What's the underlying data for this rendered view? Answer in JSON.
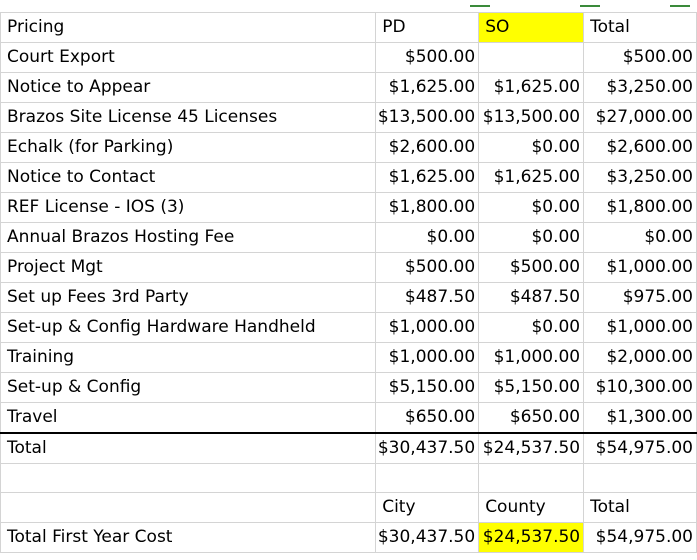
{
  "header": {
    "col0": "Pricing",
    "col1": "PD",
    "col2": "SO",
    "col3": "Total"
  },
  "rows": [
    {
      "label": "Court Export",
      "pd": "$500.00",
      "so": "",
      "total": "$500.00"
    },
    {
      "label": "Notice to Appear",
      "pd": "$1,625.00",
      "so": "$1,625.00",
      "total": "$3,250.00"
    },
    {
      "label": "Brazos Site License 45 Licenses",
      "pd": "$13,500.00",
      "so": "$13,500.00",
      "total": "$27,000.00"
    },
    {
      "label": "Echalk (for Parking)",
      "pd": "$2,600.00",
      "so": "$0.00",
      "total": "$2,600.00"
    },
    {
      "label": "Notice to Contact",
      "pd": "$1,625.00",
      "so": "$1,625.00",
      "total": "$3,250.00"
    },
    {
      "label": "REF License - IOS (3)",
      "pd": "$1,800.00",
      "so": "$0.00",
      "total": "$1,800.00"
    },
    {
      "label": "Annual Brazos Hosting Fee",
      "pd": "$0.00",
      "so": "$0.00",
      "total": "$0.00"
    },
    {
      "label": "Project Mgt",
      "pd": "$500.00",
      "so": "$500.00",
      "total": "$1,000.00"
    },
    {
      "label": "Set up Fees 3rd Party",
      "pd": "$487.50",
      "so": "$487.50",
      "total": "$975.00"
    },
    {
      "label": "Set-up & Config Hardware Handheld",
      "pd": "$1,000.00",
      "so": "$0.00",
      "total": "$1,000.00"
    },
    {
      "label": "Training",
      "pd": "$1,000.00",
      "so": "$1,000.00",
      "total": "$2,000.00"
    },
    {
      "label": "Set-up & Config",
      "pd": "$5,150.00",
      "so": "$5,150.00",
      "total": "$10,300.00"
    },
    {
      "label": "Travel",
      "pd": "$650.00",
      "so": "$650.00",
      "total": "$1,300.00"
    }
  ],
  "total_row": {
    "label": "Total",
    "pd": "$30,437.50",
    "so": "$24,537.50",
    "total": "$54,975.00"
  },
  "summary_header": {
    "col1": "City",
    "col2": "County",
    "col3": "Total"
  },
  "summary_row": {
    "label": "Total First Year Cost",
    "city": "$30,437.50",
    "county": "$24,537.50",
    "total": "$54,975.00"
  },
  "colors": {
    "highlight": "#ffff00",
    "gridline": "#d4d4d4"
  }
}
